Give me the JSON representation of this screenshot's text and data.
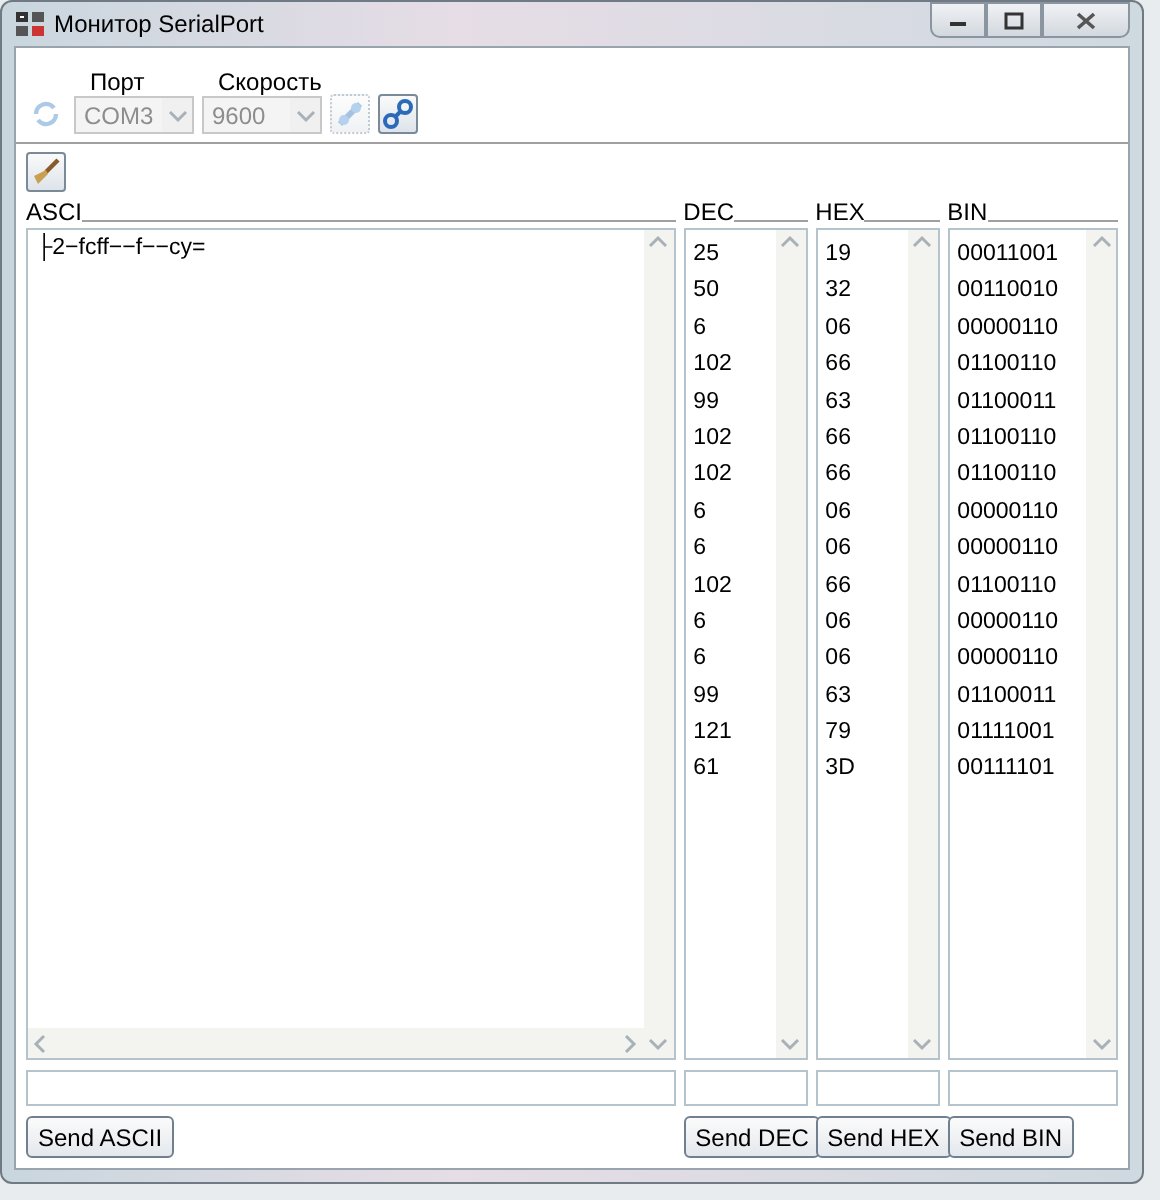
{
  "window": {
    "title": "Монитор SerialPort"
  },
  "toolbar": {
    "refresh_disabled": true,
    "port": {
      "label": "Порт",
      "value": "COM3",
      "disabled": true
    },
    "speed": {
      "label": "Скорость",
      "value": "9600",
      "disabled": true
    },
    "connect_disabled": true,
    "disconnect_disabled": false
  },
  "panels": [
    {
      "kind": "text",
      "label": "ASCI",
      "text": "├2−fcff−−f−−cy=",
      "send": "Send ASCII"
    },
    {
      "kind": "list",
      "label": "DEC",
      "lines": [
        "25",
        "50",
        "6",
        "102",
        "99",
        "102",
        "102",
        "6",
        "6",
        "102",
        "6",
        "6",
        "99",
        "121",
        "61"
      ],
      "send": "Send DEC"
    },
    {
      "kind": "list",
      "label": "HEX",
      "lines": [
        "19",
        "32",
        "06",
        "66",
        "63",
        "66",
        "66",
        "06",
        "06",
        "66",
        "06",
        "06",
        "63",
        "79",
        "3D"
      ],
      "send": "Send HEX"
    },
    {
      "kind": "list",
      "label": "BIN",
      "lines": [
        "00011001",
        "00110010",
        "00000110",
        "01100110",
        "01100011",
        "01100110",
        "01100110",
        "00000110",
        "00000110",
        "01100110",
        "00000110",
        "00000110",
        "01100011",
        "01111001",
        "00111101"
      ],
      "send": "Send BIN"
    }
  ]
}
